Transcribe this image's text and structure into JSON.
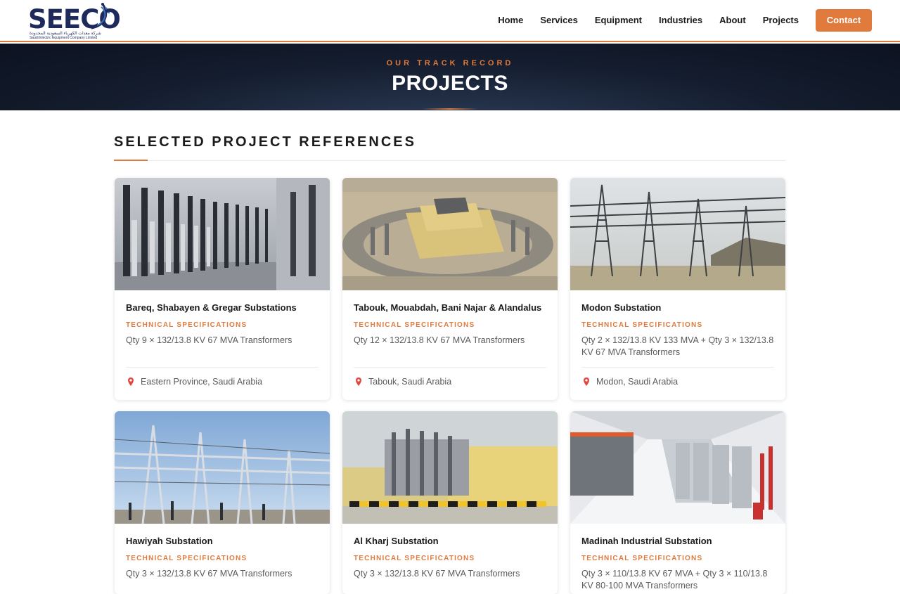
{
  "brand": {
    "name": "SEECO",
    "arabic_line": "شركة معدات الكهرباء السعودية المحدودة",
    "english_line": "Saudi Electric Equipment Company Limited"
  },
  "nav": {
    "items": [
      "Home",
      "Services",
      "Equipment",
      "Industries",
      "About",
      "Projects"
    ],
    "contact_label": "Contact"
  },
  "hero": {
    "eyebrow": "OUR TRACK RECORD",
    "title": "PROJECTS"
  },
  "section": {
    "title": "SELECTED PROJECT REFERENCES"
  },
  "colors": {
    "accent": "#e07a3d",
    "navy": "#1d2a5b",
    "hero_dark": "#141d2e"
  },
  "projects": [
    {
      "name": "Bareq, Shabayen & Gregar Substations",
      "spec_label": "TECHNICAL SPECIFICATIONS",
      "spec": "Qty 9 × 132/13.8 KV 67 MVA Transformers",
      "location": "Eastern Province, Saudi Arabia",
      "image_icon": "substation-bushings-photo"
    },
    {
      "name": "Tabouk, Mouabdah, Bani Najar & Alandalus",
      "spec_label": "TECHNICAL SPECIFICATIONS",
      "spec": "Qty 12 × 132/13.8 KV 67 MVA Transformers",
      "location": "Tabouk, Saudi Arabia",
      "image_icon": "substation-aerial-photo"
    },
    {
      "name": "Modon Substation",
      "spec_label": "TECHNICAL SPECIFICATIONS",
      "spec": "Qty 2 × 132/13.8 KV 133 MVA + Qty 3 × 132/13.8 KV 67 MVA Transformers",
      "location": "Modon, Saudi Arabia",
      "image_icon": "transmission-towers-photo"
    },
    {
      "name": "Hawiyah Substation",
      "spec_label": "TECHNICAL SPECIFICATIONS",
      "spec": "Qty 3 × 132/13.8 KV 67 MVA Transformers",
      "location": "",
      "image_icon": "gantry-structures-photo"
    },
    {
      "name": "Al Kharj Substation",
      "spec_label": "TECHNICAL SPECIFICATIONS",
      "spec": "Qty 3 × 132/13.8 KV 67 MVA Transformers",
      "location": "",
      "image_icon": "transformer-yard-photo"
    },
    {
      "name": "Madinah Industrial Substation",
      "spec_label": "TECHNICAL SPECIFICATIONS",
      "spec": "Qty 3 × 110/13.8 KV 67 MVA + Qty 3 × 110/13.8 KV 80-100 MVA Transformers",
      "location": "",
      "image_icon": "switchgear-room-photo"
    }
  ]
}
